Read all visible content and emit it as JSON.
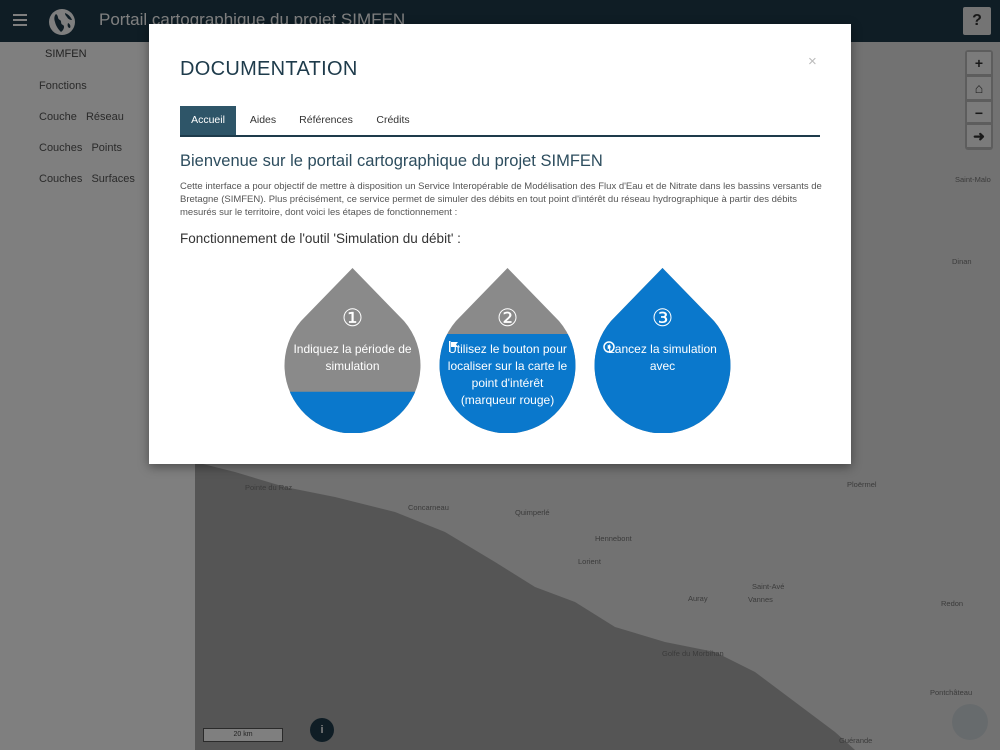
{
  "header": {
    "title": "Portail cartographique du projet SIMFEN",
    "help_label": "?"
  },
  "sidebar": {
    "title": "SIMFEN",
    "items": [
      {
        "label": "Fonctions"
      },
      {
        "label": "Couche Réseau"
      },
      {
        "label": "Couches Points"
      },
      {
        "label": "Couches Surfaces"
      }
    ]
  },
  "map": {
    "places": [
      "Saint-Malo",
      "Dinan",
      "Pointe du Raz",
      "Concarneau",
      "Quimperlé",
      "Hennebont",
      "Lorient",
      "Auray",
      "Saint-Avé",
      "Vannes",
      "Ploërmel",
      "Redon",
      "Golfe du Morbihan",
      "Pontchâteau",
      "Guérande"
    ],
    "zoom_in": "+",
    "home": "⌂",
    "zoom_out": "−",
    "locate": "➜",
    "scale": "20 km",
    "info": "i"
  },
  "modal": {
    "title": "DOCUMENTATION",
    "close": "×",
    "tabs": [
      {
        "label": "Accueil",
        "active": true
      },
      {
        "label": "Aides"
      },
      {
        "label": "Références"
      },
      {
        "label": "Crédits"
      }
    ],
    "heading": "Bienvenue sur le portail cartographique du projet SIMFEN",
    "intro": "Cette interface a pour objectif de mettre à disposition un Service Interopérable de Modélisation des Flux d'Eau et de Nitrate dans les bassins versants de Bretagne (SIMFEN). Plus précisément, ce service permet de simuler des débits en tout point d'intérêt du réseau hydrographique à partir des débits mesurés sur le territoire, dont voici les étapes de fonctionnement :",
    "section": "Fonctionnement de l'outil 'Simulation du débit' :",
    "steps": [
      {
        "number": "①",
        "text": "Indiquez la période de simulation",
        "fill_level": 0.25
      },
      {
        "number": "②",
        "text": "Utilisez le bouton",
        "text2": "pour localiser sur la carte le point d'intérêt (marqueur rouge)",
        "icon": "flag-icon",
        "fill_level": 0.6
      },
      {
        "number": "③",
        "text": "Lancez la simulation avec",
        "icon": "play-circle-icon",
        "fill_level": 1.0
      }
    ]
  },
  "colors": {
    "header": "#1e3b4b",
    "tab_active": "#2e5568",
    "drop_gray": "#8a8a8a",
    "drop_blue": "#0a78cc"
  }
}
